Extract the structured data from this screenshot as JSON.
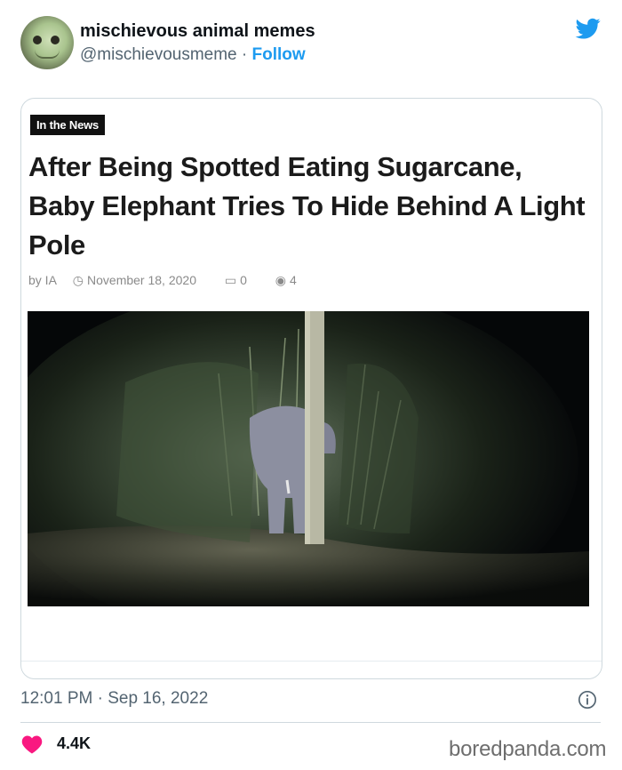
{
  "tweet": {
    "author_name": "mischievous animal memes",
    "handle": "@mischievousmeme",
    "separator": " · ",
    "follow_label": "Follow",
    "timestamp": "12:01 PM · Sep 16, 2022",
    "likes": "4.4K"
  },
  "article": {
    "tag": "In the News",
    "headline": "After Being Spotted Eating Sugarcane, Baby Elephant Tries To Hide Behind A Light Pole",
    "byline": "by IA",
    "date": "November 18, 2020",
    "comments": "0",
    "views": "4"
  },
  "watermark": "boredpanda.com",
  "colors": {
    "accent": "#1d9bf0",
    "heart": "#f91880",
    "text_secondary": "#536471"
  },
  "icons": {
    "brand": "twitter-bird-icon",
    "info": "info-icon",
    "like": "heart-icon"
  }
}
